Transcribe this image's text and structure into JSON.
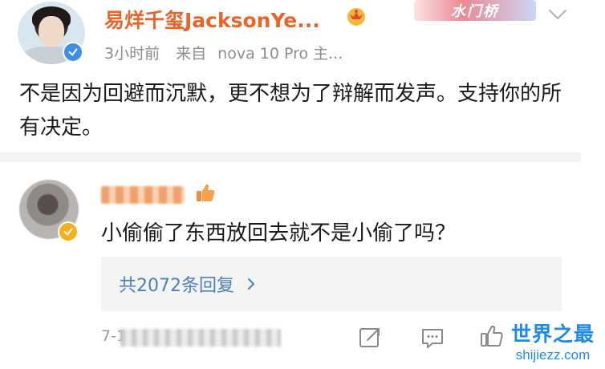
{
  "post": {
    "username": "易烊千玺JacksonYe...",
    "time": "3小时前",
    "source_prefix": "来自",
    "device": "nova 10 Pro 主...",
    "text": "不是因为回避而沉默，更不想为了辩解而发声。支持你的所有决定。",
    "banner_text": "水门桥"
  },
  "comment": {
    "username": "",
    "text": "小偷偷了东西放回去就不是小偷了吗？",
    "replies_label": "共2072条回复",
    "timestamp": "7-1"
  },
  "icons": {
    "verified_badge": "check-badge-icon",
    "crown": "crown-icon",
    "more": "chevron-down-icon",
    "share": "share-icon",
    "comment": "comment-icon",
    "like": "thumb-up-icon"
  },
  "watermark": {
    "title": "世界之最",
    "url": "shijiezz.com"
  },
  "colors": {
    "username_orange": "#e8652a",
    "link_blue": "#4b7fbf",
    "verified_blue": "#3d8fe6",
    "verified_gold": "#f5b01e",
    "watermark_blue": "#1f8be8"
  }
}
